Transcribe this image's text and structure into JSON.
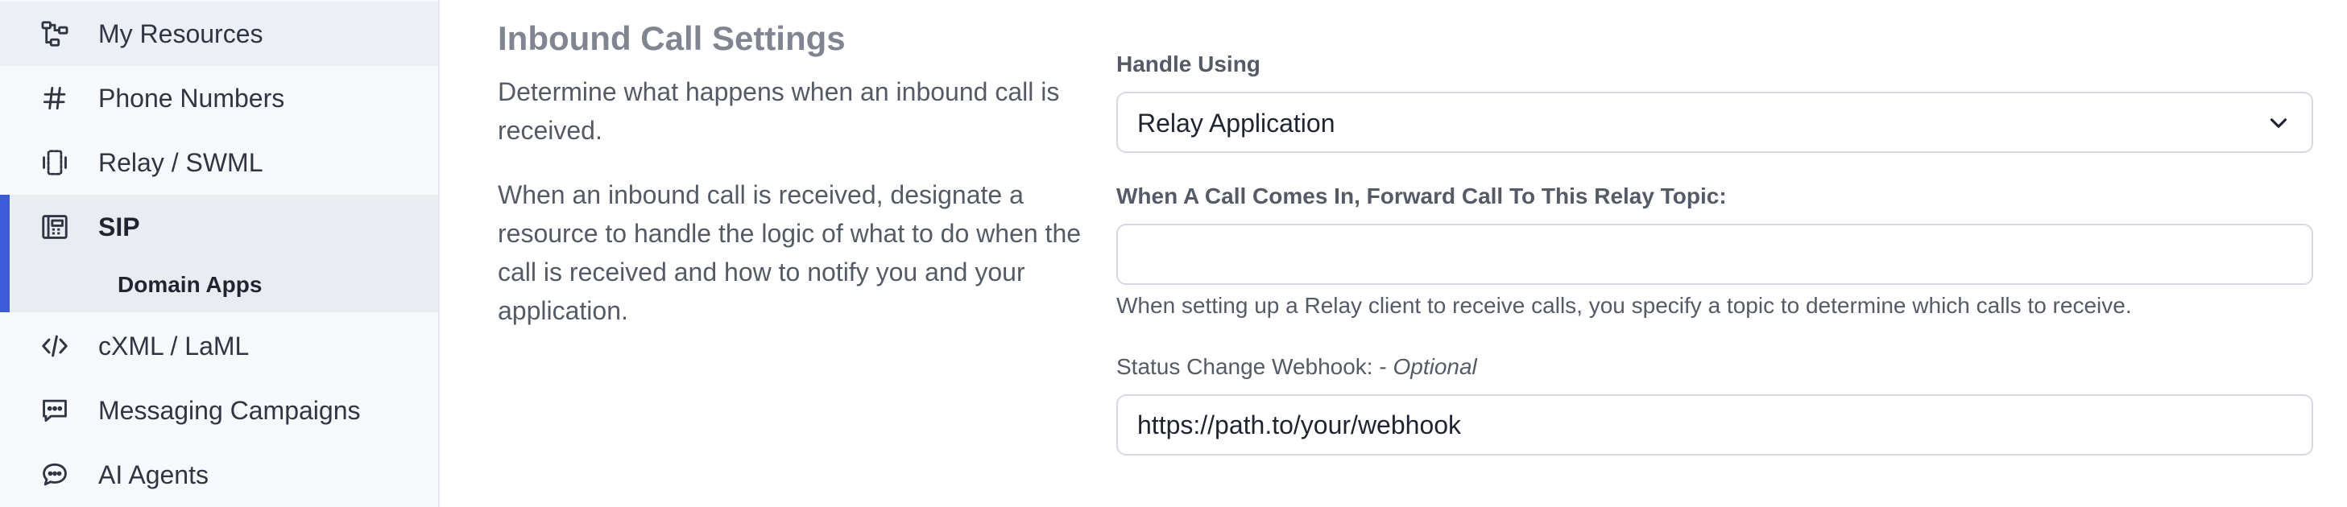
{
  "sidebar": {
    "items": [
      {
        "label": "My Resources",
        "icon": "resources-icon"
      },
      {
        "label": "Phone Numbers",
        "icon": "hash-icon"
      },
      {
        "label": "Relay / SWML",
        "icon": "relay-icon"
      },
      {
        "label": "SIP",
        "icon": "sip-icon"
      },
      {
        "label": "cXML / LaML",
        "icon": "code-icon"
      },
      {
        "label": "Messaging Campaigns",
        "icon": "message-icon"
      },
      {
        "label": "AI Agents",
        "icon": "chat-bubble-icon"
      }
    ],
    "sub_item": {
      "label": "Domain Apps"
    },
    "accent_color": "#3b5bdb"
  },
  "main": {
    "title": "Inbound Call Settings",
    "description_1": "Determine what happens when an inbound call is received.",
    "description_2": "When an inbound call is received, designate a resource to handle the logic of what to do when the call is received and how to notify you and your application.",
    "handle_using": {
      "label": "Handle Using",
      "value": "Relay Application"
    },
    "relay_topic": {
      "label": "When A Call Comes In, Forward Call To This Relay Topic:",
      "value": "",
      "help": "When setting up a Relay client to receive calls, you specify a topic to determine which calls to receive."
    },
    "webhook": {
      "label": "Status Change Webhook: -",
      "optional": "Optional",
      "value": "https://path.to/your/webhook"
    }
  }
}
